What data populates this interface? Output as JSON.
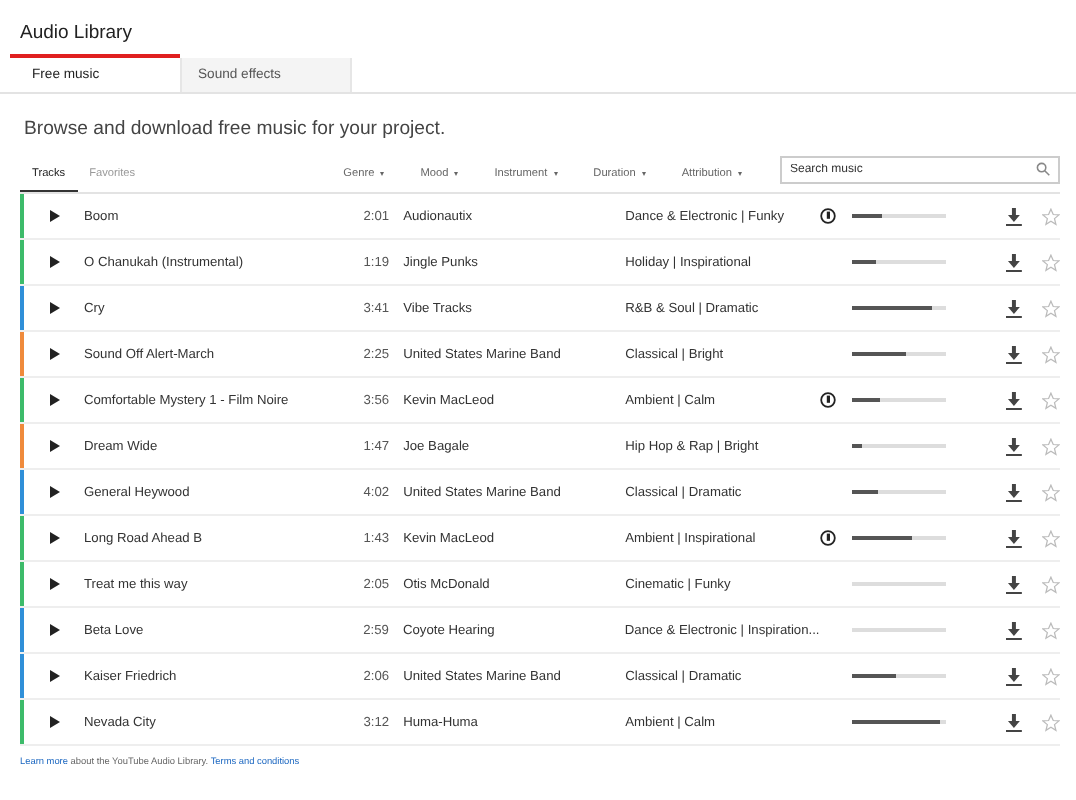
{
  "title": "Audio Library",
  "tabs": [
    {
      "label": "Free music",
      "selected": true
    },
    {
      "label": "Sound effects",
      "selected": false
    }
  ],
  "heading": "Browse and download free music for your project.",
  "subtabs": [
    {
      "label": "Tracks",
      "selected": true
    },
    {
      "label": "Favorites",
      "selected": false
    }
  ],
  "filters": [
    "Genre",
    "Mood",
    "Instrument",
    "Duration",
    "Attribution"
  ],
  "search": {
    "placeholder": "Search music"
  },
  "tracks": [
    {
      "title": "Boom",
      "duration": "2:01",
      "artist": "Audionautix",
      "genre": "Dance & Electronic | Funky",
      "attribution": true,
      "level": 0.33,
      "color": "#3dbb6a"
    },
    {
      "title": "O Chanukah (Instrumental)",
      "duration": "1:19",
      "artist": "Jingle Punks",
      "genre": "Holiday | Inspirational",
      "attribution": false,
      "level": 0.27,
      "color": "#3dbb6a"
    },
    {
      "title": "Cry",
      "duration": "3:41",
      "artist": "Vibe Tracks",
      "genre": "R&B & Soul | Dramatic",
      "attribution": false,
      "level": 0.85,
      "color": "#2f8fd8"
    },
    {
      "title": "Sound Off Alert-March",
      "duration": "2:25",
      "artist": "United States Marine Band",
      "genre": "Classical | Bright",
      "attribution": false,
      "level": 0.58,
      "color": "#ef8a3c"
    },
    {
      "title": "Comfortable Mystery 1 - Film Noire",
      "duration": "3:56",
      "artist": "Kevin MacLeod",
      "genre": "Ambient | Calm",
      "attribution": true,
      "level": 0.3,
      "color": "#3dbb6a"
    },
    {
      "title": "Dream Wide",
      "duration": "1:47",
      "artist": "Joe Bagale",
      "genre": "Hip Hop & Rap | Bright",
      "attribution": false,
      "level": 0.12,
      "color": "#ef8a3c"
    },
    {
      "title": "General Heywood",
      "duration": "4:02",
      "artist": "United States Marine Band",
      "genre": "Classical | Dramatic",
      "attribution": false,
      "level": 0.28,
      "color": "#2f8fd8"
    },
    {
      "title": "Long Road Ahead B",
      "duration": "1:43",
      "artist": "Kevin MacLeod",
      "genre": "Ambient | Inspirational",
      "attribution": true,
      "level": 0.63,
      "color": "#3dbb6a"
    },
    {
      "title": "Treat me this way",
      "duration": "2:05",
      "artist": "Otis McDonald",
      "genre": "Cinematic | Funky",
      "attribution": false,
      "level": 0,
      "color": "#3dbb6a"
    },
    {
      "title": "Beta Love",
      "duration": "2:59",
      "artist": "Coyote Hearing",
      "genre": "Dance & Electronic | Inspiration...",
      "attribution": false,
      "level": 0,
      "color": "#2f8fd8"
    },
    {
      "title": "Kaiser Friedrich",
      "duration": "2:06",
      "artist": "United States Marine Band",
      "genre": "Classical | Dramatic",
      "attribution": false,
      "level": 0.48,
      "color": "#2f8fd8"
    },
    {
      "title": "Nevada City",
      "duration": "3:12",
      "artist": "Huma-Huma",
      "genre": "Ambient | Calm",
      "attribution": false,
      "level": 0.93,
      "color": "#3dbb6a"
    }
  ],
  "footer": {
    "link": "Learn more",
    "text": "about the YouTube Audio Library.",
    "terms": "Terms and conditions"
  }
}
